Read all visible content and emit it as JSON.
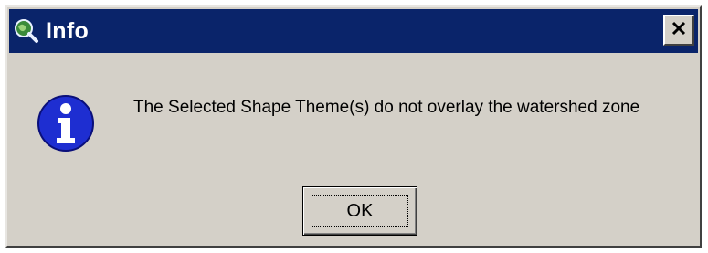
{
  "dialog": {
    "title": "Info",
    "app_icon": "globe-magnifier-icon",
    "close_label": "×",
    "message_icon": "info-icon",
    "message": "The Selected Shape Theme(s) do not overlay the watershed zone",
    "ok_label": "OK"
  },
  "colors": {
    "titlebar": "#0a246a",
    "dialog_face": "#d4d0c8",
    "info_blue": "#1e2ed1"
  }
}
